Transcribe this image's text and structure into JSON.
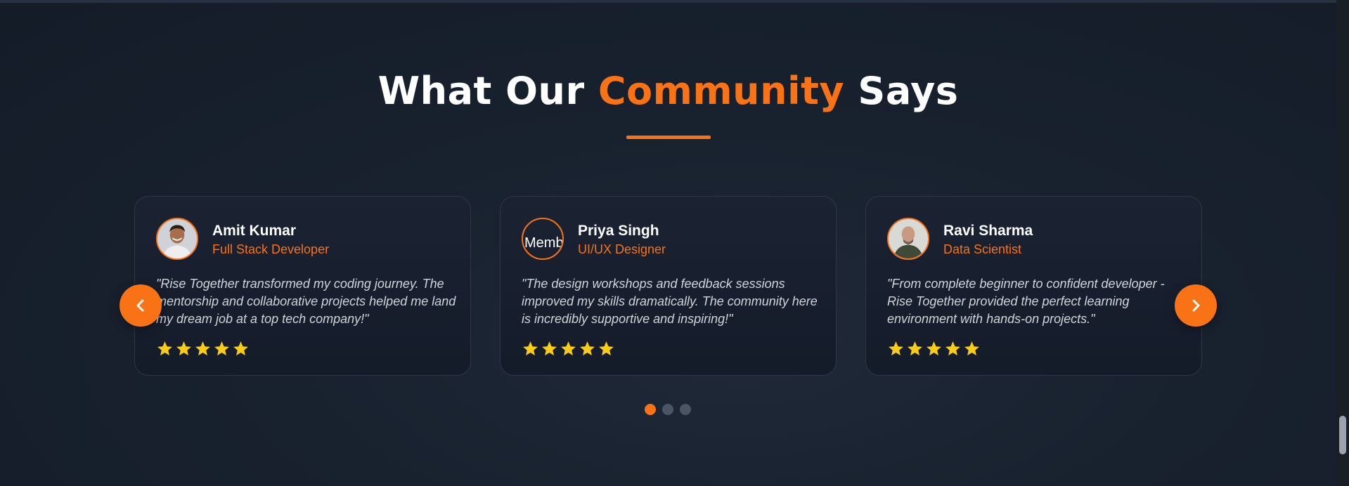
{
  "section": {
    "heading_prefix": "What Our",
    "heading_accent": "Community",
    "heading_suffix": "Says"
  },
  "testimonials": [
    {
      "name": "Amit Kumar",
      "role": "Full Stack Developer",
      "quote": "\"Rise Together transformed my coding journey. The mentorship and collaborative projects helped me land my dream job at a top tech company!\"",
      "rating": 5
    },
    {
      "name": "Priya Singh",
      "role": "UI/UX Designer",
      "avatar_alt": "Memb",
      "quote": "\"The design workshops and feedback sessions improved my skills dramatically. The community here is incredibly supportive and inspiring!\"",
      "rating": 5
    },
    {
      "name": "Ravi Sharma",
      "role": "Data Scientist",
      "quote": "\"From complete beginner to confident developer - Rise Together provided the perfect learning environment with hands-on projects.\"",
      "rating": 5
    }
  ],
  "carousel": {
    "prev_icon": "chevron-left-icon",
    "next_icon": "chevron-right-icon",
    "active_dot": 0,
    "dot_count": 3
  },
  "colors": {
    "accent": "#f97316",
    "star": "#facc15",
    "card_border": "#2d3748"
  }
}
